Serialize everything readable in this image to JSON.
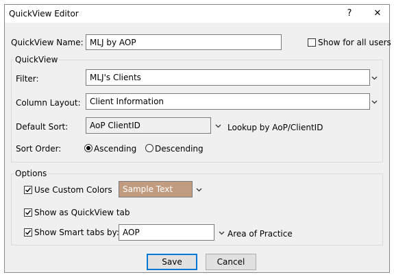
{
  "window": {
    "title": "QuickView Editor",
    "help_glyph": "?",
    "close_glyph": "✕"
  },
  "name_row": {
    "label": "QuickView Name:",
    "value": "MLJ by AOP",
    "show_all_users_label": "Show for all users",
    "show_all_users_checked": false
  },
  "quickview_group": {
    "title": "QuickView",
    "filter": {
      "label": "Filter:",
      "value": "MLJ's Clients"
    },
    "column_layout": {
      "label": "Column Layout:",
      "value": "Client Information"
    },
    "default_sort": {
      "label": "Default Sort:",
      "value": "AoP ClientID",
      "note": "Lookup by AoP/ClientID"
    },
    "sort_order": {
      "label": "Sort Order:",
      "options": [
        "Ascending",
        "Descending"
      ],
      "selected": "Ascending"
    }
  },
  "options_group": {
    "title": "Options",
    "custom_colors": {
      "label": "Use Custom Colors",
      "checked": true,
      "sample_text": "Sample Text",
      "sample_color": "#c29c80"
    },
    "quickview_tab": {
      "label": "Show as QuickView tab",
      "checked": true
    },
    "smart_tabs": {
      "label": "Show Smart tabs by:",
      "checked": true,
      "value": "AOP",
      "note": "Area of Practice"
    }
  },
  "buttons": {
    "save": "Save",
    "cancel": "Cancel"
  },
  "colors": {
    "dialog_bg": "#f0f0f0",
    "default_button_border": "#0078d7"
  }
}
